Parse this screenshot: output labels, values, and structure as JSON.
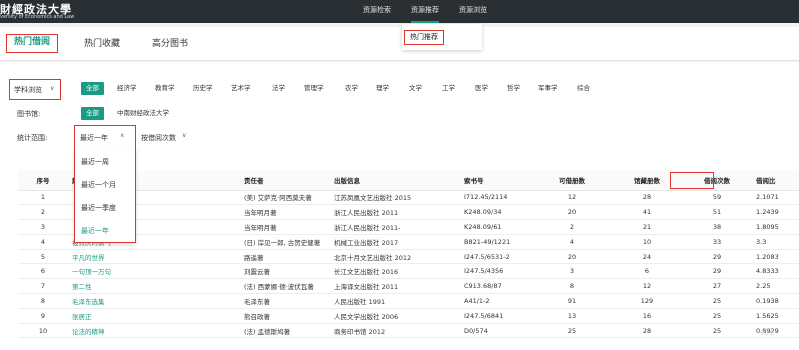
{
  "header": {
    "logo_cn": "財經政法大學",
    "logo_en": "versity of Economics and Law",
    "nav": [
      {
        "label": "资源检索"
      },
      {
        "label": "资源推荐"
      },
      {
        "label": "资源浏览"
      }
    ],
    "recommend_menu": {
      "item": "热门推荐"
    }
  },
  "tabs": [
    {
      "label": "热门借阅",
      "active": true
    },
    {
      "label": "热门收藏",
      "active": false
    },
    {
      "label": "高分图书",
      "active": false
    }
  ],
  "filters": {
    "subject_label": "学科浏览",
    "subjects": [
      "全部",
      "经济学",
      "教育学",
      "历史学",
      "艺术学",
      "法学",
      "管理学",
      "农学",
      "理学",
      "文学",
      "工学",
      "医学",
      "哲学",
      "军事学",
      "综合"
    ],
    "library_label": "图书馆:",
    "libraries": [
      "全部",
      "中南财经政法大学"
    ],
    "range_label": "统计范围:",
    "range_selected": "最近一年",
    "range_options": [
      "最近一周",
      "最近一个月",
      "最近一季度",
      "最近一年"
    ],
    "order_selected": "按借阅次数"
  },
  "table": {
    "headers": [
      "序号",
      "题名",
      "责任者",
      "出版信息",
      "索书号",
      "可借册数",
      "馆藏册数",
      "借阅次数",
      "借阅比"
    ],
    "rows": [
      {
        "no": "1",
        "title": "",
        "author": "(美) 艾萨克·阿西莫夫著",
        "pub": "江苏凤凰文艺出版社 2015",
        "call": "I712.45/2114",
        "avail": "12",
        "total": "28",
        "loans": "59",
        "ratio": "2.1071"
      },
      {
        "no": "2",
        "title": "",
        "author": "当年明月著",
        "pub": "浙江人民出版社 2011",
        "call": "K248.09/34",
        "avail": "20",
        "total": "41",
        "loans": "51",
        "ratio": "1.2439"
      },
      {
        "no": "3",
        "title": "",
        "author": "当年明月著",
        "pub": "浙江人民出版社 2011-",
        "call": "K248.09/61",
        "avail": "2",
        "total": "21",
        "loans": "38",
        "ratio": "1.8095"
      },
      {
        "no": "4",
        "title": "被讨厌的勇气",
        "author": "(日) 岸见一郎, 古贺史健著",
        "pub": "机械工业出版社 2017",
        "call": "B821-49/1221",
        "avail": "4",
        "total": "10",
        "loans": "33",
        "ratio": "3.3"
      },
      {
        "no": "5",
        "title": "平凡的世界",
        "author": "路遥著",
        "pub": "北京十月文艺出版社 2012",
        "call": "I247.5/6531-2",
        "avail": "20",
        "total": "24",
        "loans": "29",
        "ratio": "1.2083"
      },
      {
        "no": "6",
        "title": "一句顶一万句",
        "author": "刘震云著",
        "pub": "长江文艺出版社 2016",
        "call": "I247.5/4356",
        "avail": "3",
        "total": "6",
        "loans": "29",
        "ratio": "4.8333"
      },
      {
        "no": "7",
        "title": "第二性",
        "author": "(法) 西蒙娜·德·波伏瓦著",
        "pub": "上海译文出版社 2011",
        "call": "C913.68/87",
        "avail": "8",
        "total": "12",
        "loans": "27",
        "ratio": "2.25"
      },
      {
        "no": "8",
        "title": "毛泽东选集",
        "author": "毛泽东著",
        "pub": "人民出版社 1991",
        "call": "A41/1-2",
        "avail": "91",
        "total": "129",
        "loans": "25",
        "ratio": "0.1938"
      },
      {
        "no": "9",
        "title": "张居正",
        "author": "熊召政著",
        "pub": "人民文学出版社 2006",
        "call": "I247.5/6841",
        "avail": "13",
        "total": "16",
        "loans": "25",
        "ratio": "1.5625"
      },
      {
        "no": "10",
        "title": "论法的精神",
        "author": "(法) 孟德斯鸠著",
        "pub": "商务印书馆 2012",
        "call": "D0/574",
        "avail": "25",
        "total": "28",
        "loans": "25",
        "ratio": "0.8929"
      }
    ]
  },
  "colors": {
    "accent": "#1a9b84",
    "highlight": "#e0342f",
    "topbar": "#2a2f33"
  }
}
